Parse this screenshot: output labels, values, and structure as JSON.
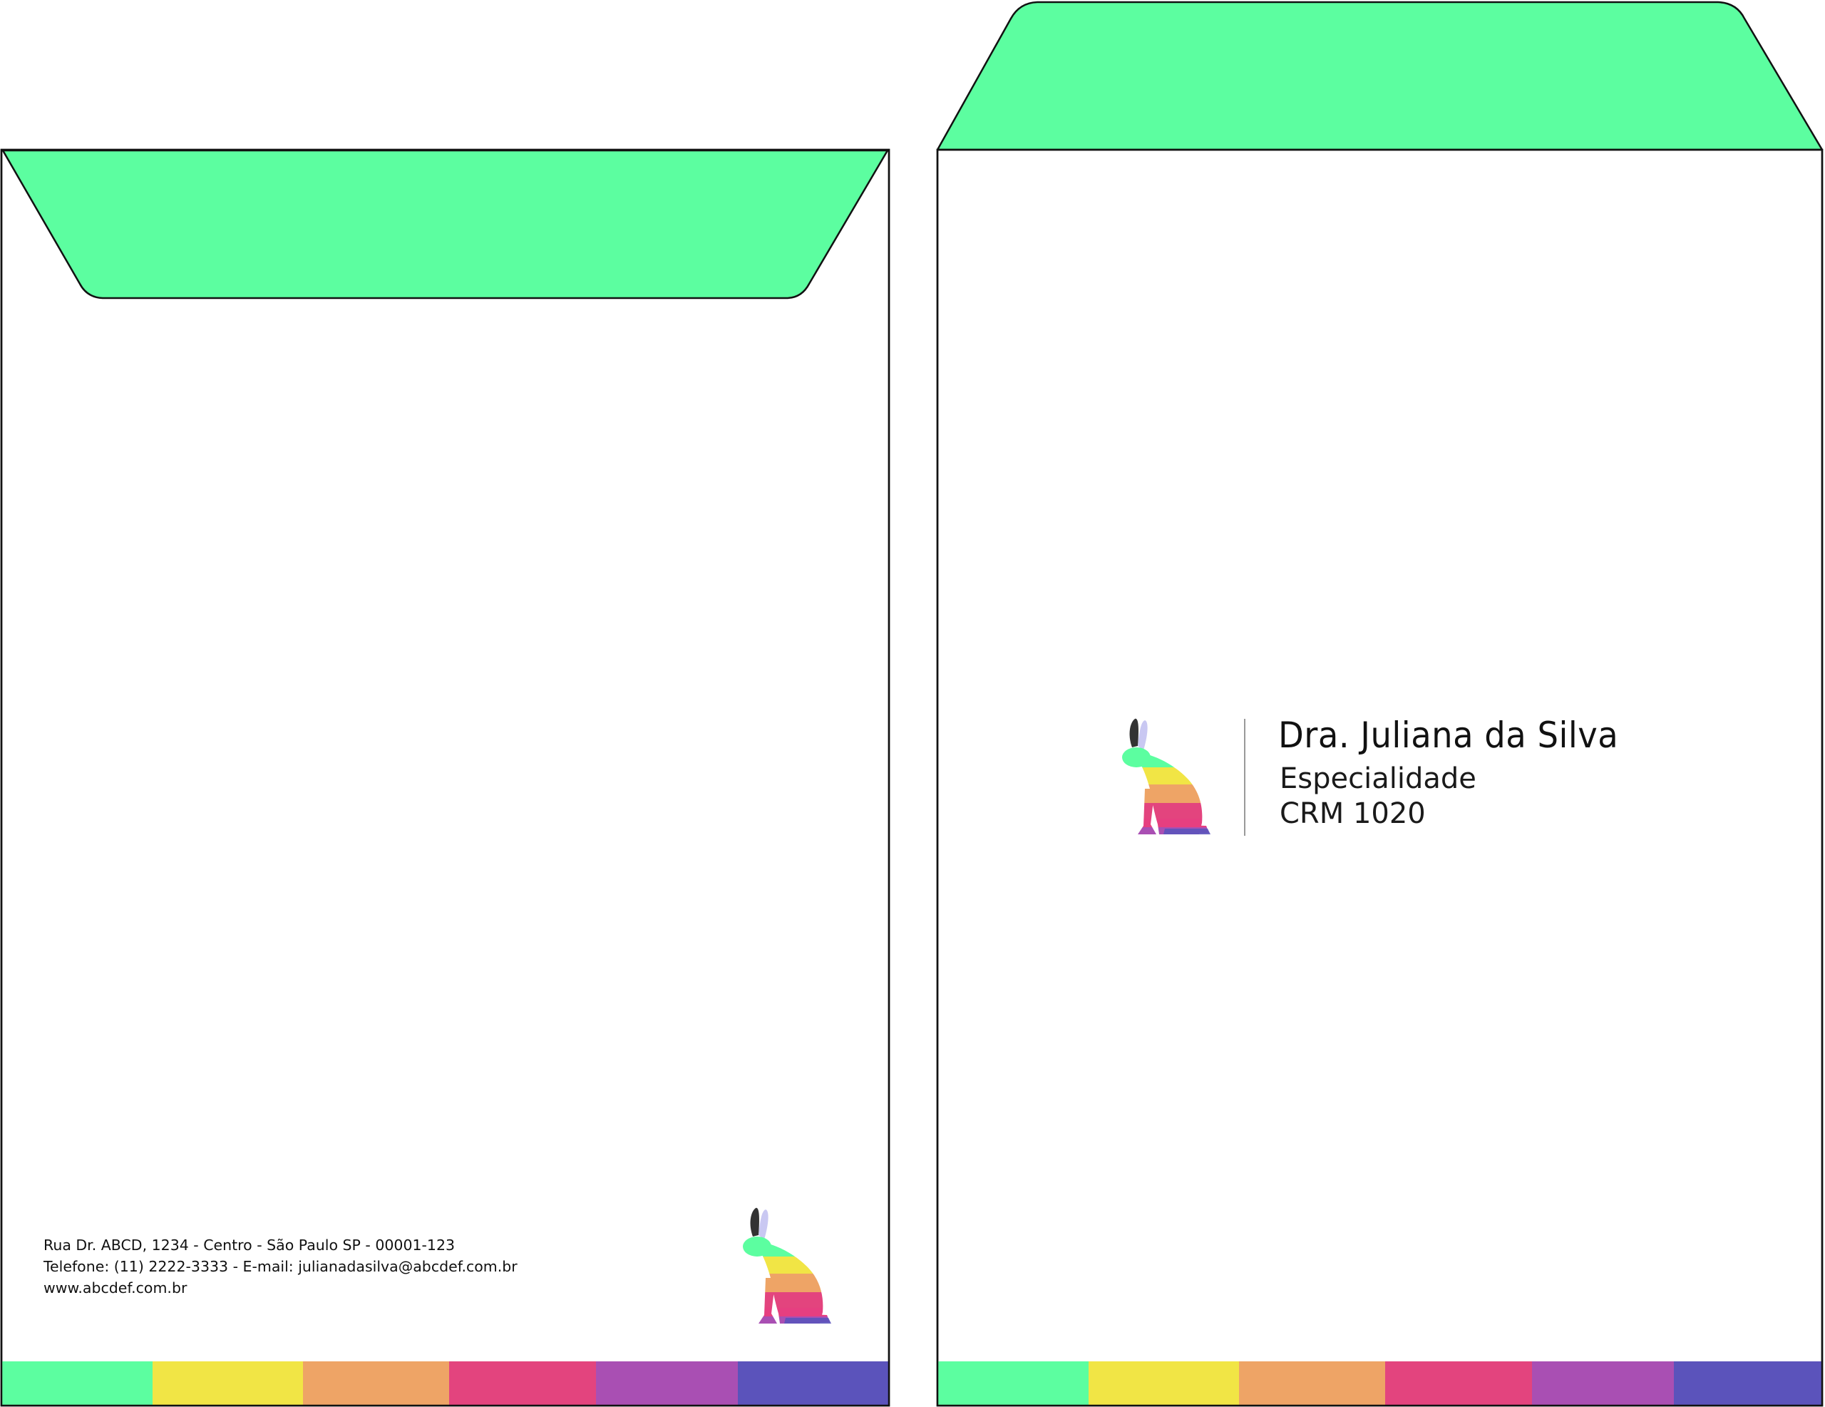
{
  "back_envelope": {
    "address_line_1": "Rua Dr. ABCD, 1234 - Centro - São Paulo SP - 00001-123",
    "address_line_2": "Telefone: (11) 2222-3333 - E-mail: julianadasilva@abcdef.com.br",
    "address_line_3": "www.abcdef.com.br"
  },
  "front_envelope": {
    "name": "Dra. Juliana da Silva",
    "specialty": "Especialidade",
    "crm": "CRM 1020"
  },
  "colors": {
    "flap": "#5cfea0",
    "outline": "#111111",
    "stripe": [
      "#5cfea0",
      "#f1e545",
      "#eea466",
      "#e3447e",
      "#a94fb3",
      "#5b53bb"
    ],
    "divider": "#9a9a9a"
  },
  "icons": {
    "logo": "rainbow-rabbit-logo-icon"
  }
}
